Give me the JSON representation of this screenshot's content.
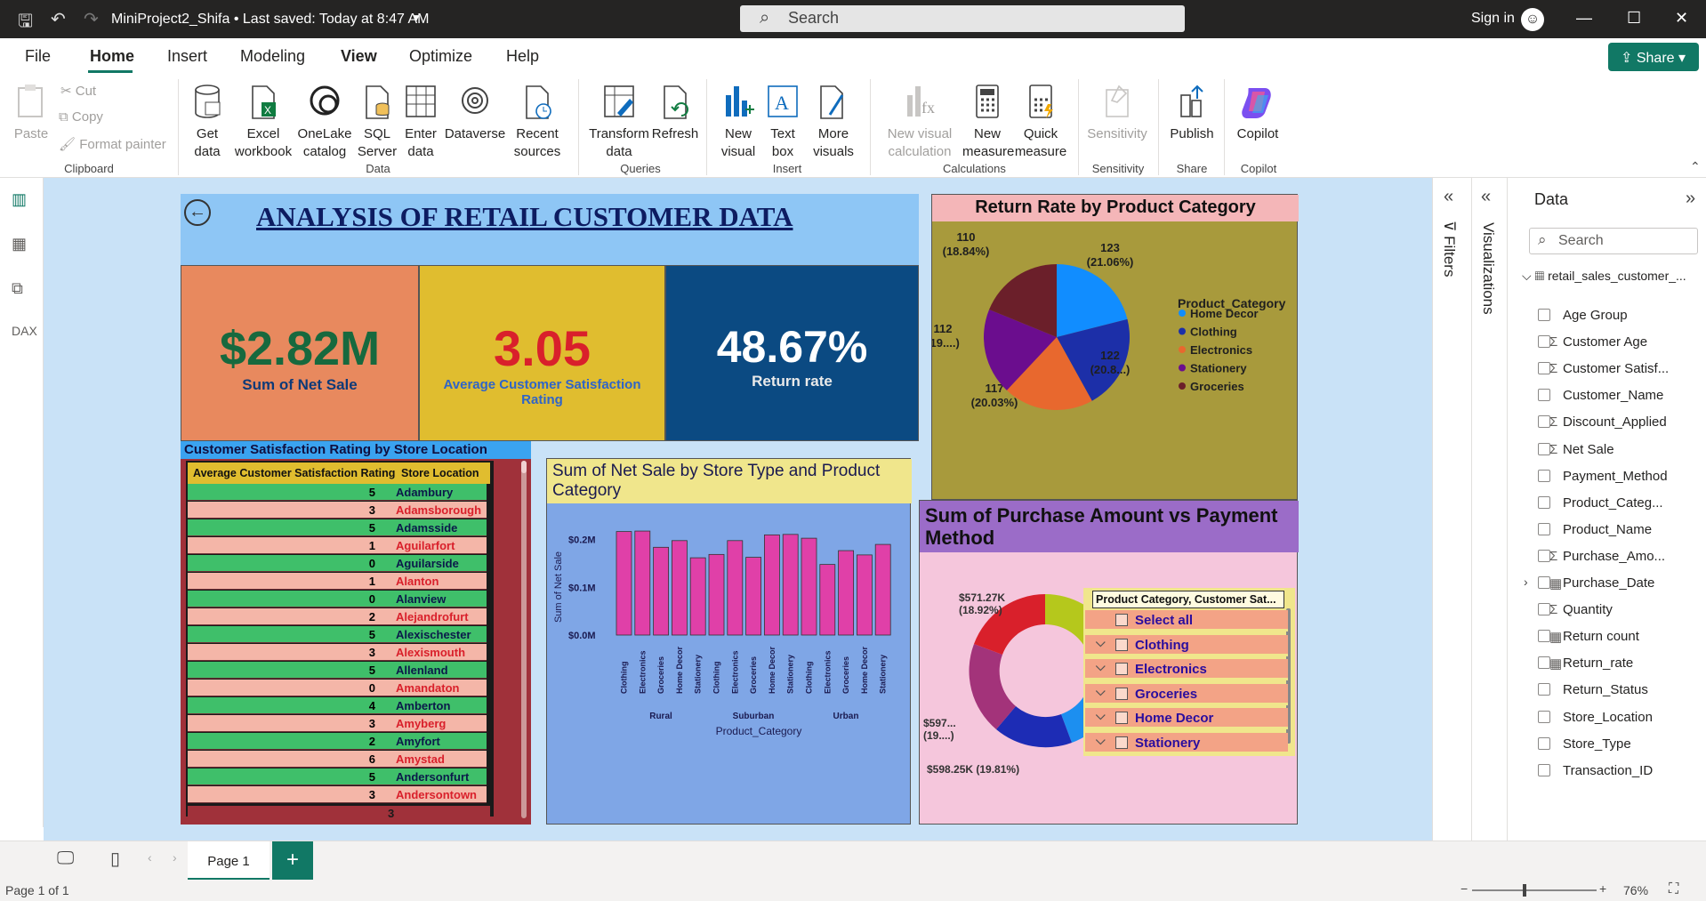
{
  "app": {
    "doc_title": "MiniProject2_Shifa • Last saved: Today at 8:47 AM",
    "search_placeholder": "Search",
    "sign_in": "Sign in",
    "share": "Share"
  },
  "menu": [
    "File",
    "Home",
    "Insert",
    "Modeling",
    "View",
    "Optimize",
    "Help"
  ],
  "ribbon": {
    "clipboard": {
      "paste": "Paste",
      "cut": "Cut",
      "copy": "Copy",
      "format_painter": "Format painter",
      "group": "Clipboard"
    },
    "data": {
      "get_data": "Get data",
      "excel": "Excel workbook",
      "onelake": "OneLake catalog",
      "sql": "SQL Server",
      "enter": "Enter data",
      "dataverse": "Dataverse",
      "recent": "Recent sources",
      "group": "Data"
    },
    "queries": {
      "transform": "Transform data",
      "refresh": "Refresh",
      "group": "Queries"
    },
    "insert": {
      "new_visual": "New visual",
      "text_box": "Text box",
      "more_visuals": "More visuals",
      "group": "Insert"
    },
    "calculations": {
      "new_visual_calc": "New visual calculation",
      "new_measure": "New measure",
      "quick_measure": "Quick measure",
      "group": "Calculations"
    },
    "sensitivity": {
      "label": "Sensitivity",
      "group": "Sensitivity"
    },
    "share": {
      "publish": "Publish",
      "group": "Share"
    },
    "copilot": {
      "label": "Copilot",
      "group": "Copilot"
    }
  },
  "report": {
    "title": "ANALYSIS OF RETAIL CUSTOMER DATA",
    "kpis": [
      {
        "value": "$2.82M",
        "label": "Sum of Net Sale",
        "bg": "#e8895e",
        "color": "#17693e"
      },
      {
        "value": "3.05",
        "label": "Average Customer Satisfaction Rating",
        "bg": "#e0bd2f",
        "color": "#d9202b"
      },
      {
        "value": "48.67%",
        "label": "Return rate",
        "bg": "#0b4a82",
        "color": "#ffffff"
      }
    ],
    "table": {
      "title": "Customer Satisfaction Rating by Store Location",
      "col1": "Average Customer Satisfaction Rating",
      "col2": "Store Location",
      "rows": [
        [
          "5",
          "Adambury"
        ],
        [
          "3",
          "Adamsborough"
        ],
        [
          "5",
          "Adamsside"
        ],
        [
          "1",
          "Aguilarfort"
        ],
        [
          "0",
          "Aguilarside"
        ],
        [
          "1",
          "Alanton"
        ],
        [
          "0",
          "Alanview"
        ],
        [
          "2",
          "Alejandrofurt"
        ],
        [
          "5",
          "Alexischester"
        ],
        [
          "3",
          "Alexismouth"
        ],
        [
          "5",
          "Allenland"
        ],
        [
          "0",
          "Amandaton"
        ],
        [
          "4",
          "Amberton"
        ],
        [
          "3",
          "Amyberg"
        ],
        [
          "2",
          "Amyfort"
        ],
        [
          "6",
          "Amystad"
        ],
        [
          "5",
          "Andersonfurt"
        ],
        [
          "3",
          "Andersontown"
        ]
      ],
      "total": "3"
    },
    "pie": {
      "title": "Return Rate by Product Category",
      "legend_title": "Product_Category",
      "slices": [
        {
          "name": "Home Decor",
          "value": 123,
          "label": "123",
          "pct": "(21.06%)",
          "color": "#118dff"
        },
        {
          "name": "Clothing",
          "value": 122,
          "label": "122",
          "pct": "(20.8...)",
          "color": "#1c2fa8"
        },
        {
          "name": "Electronics",
          "value": 117,
          "label": "117",
          "pct": "(20.03%)",
          "color": "#e8682e"
        },
        {
          "name": "Stationery",
          "value": 112,
          "label": "112",
          "pct": "(19....)",
          "color": "#6b0d8e"
        },
        {
          "name": "Groceries",
          "value": 110,
          "label": "110",
          "pct": "(18.84%)",
          "color": "#6b1f2a"
        }
      ]
    },
    "bar": {
      "title": "Sum of Net Sale by Store Type and Product Category",
      "ylabel": "Sum of Net Sale",
      "xlabel": "Product_Category",
      "yticks": [
        "$0.2M",
        "$0.1M",
        "$0.0M"
      ]
    },
    "donut": {
      "title": "Sum of Purchase Amount vs Payment Method",
      "labels": [
        {
          "value": "$571.27K",
          "pct": "(18.92%)"
        },
        {
          "value": "$597...",
          "pct": "(19....)"
        },
        {
          "value": "$598.25K (19.81%)",
          "pct": ""
        }
      ]
    },
    "slicer": {
      "header": "Product Category, Customer Sat...",
      "items": [
        "Select all",
        "Clothing",
        "Electronics",
        "Groceries",
        "Home Decor",
        "Stationery"
      ]
    }
  },
  "chart_data": {
    "type": "bar",
    "title": "Sum of Net Sale by Store Type and Product Category",
    "xlabel": "Product_Category",
    "ylabel": "Sum of Net Sale",
    "ylim": [
      0,
      0.22
    ],
    "groups": [
      "Rural",
      "Suburban",
      "Urban"
    ],
    "categories": [
      "Clothing",
      "Electronics",
      "Groceries",
      "Home Decor",
      "Stationery"
    ],
    "series": [
      {
        "name": "Rural",
        "values": [
          0.217,
          0.218,
          0.184,
          0.198,
          0.162
        ]
      },
      {
        "name": "Suburban",
        "values": [
          0.169,
          0.198,
          0.163,
          0.21,
          0.211
        ]
      },
      {
        "name": "Urban",
        "values": [
          0.203,
          0.148,
          0.177,
          0.168,
          0.19
        ]
      }
    ],
    "color": "#e040a8"
  },
  "pages": {
    "tab": "Page 1",
    "status": "Page 1 of 1",
    "zoom": "76%"
  },
  "panes": {
    "filters": "Filters",
    "visualizations": "Visualizations",
    "data": "Data",
    "search": "Search"
  },
  "fields": {
    "table": "retail_sales_customer_...",
    "items": [
      {
        "name": "Age Group",
        "icon": ""
      },
      {
        "name": "Customer Age",
        "icon": "Σ"
      },
      {
        "name": "Customer Satisf...",
        "icon": "Σ"
      },
      {
        "name": "Customer_Name",
        "icon": ""
      },
      {
        "name": "Discount_Applied",
        "icon": "Σ"
      },
      {
        "name": "Net Sale",
        "icon": "Σ"
      },
      {
        "name": "Payment_Method",
        "icon": ""
      },
      {
        "name": "Product_Categ...",
        "icon": ""
      },
      {
        "name": "Product_Name",
        "icon": ""
      },
      {
        "name": "Purchase_Amo...",
        "icon": "Σ"
      },
      {
        "name": "Purchase_Date",
        "icon": "▦"
      },
      {
        "name": "Quantity",
        "icon": "Σ"
      },
      {
        "name": "Return count",
        "icon": "▦"
      },
      {
        "name": "Return_rate",
        "icon": "▦"
      },
      {
        "name": "Return_Status",
        "icon": ""
      },
      {
        "name": "Store_Location",
        "icon": ""
      },
      {
        "name": "Store_Type",
        "icon": ""
      },
      {
        "name": "Transaction_ID",
        "icon": ""
      }
    ]
  }
}
